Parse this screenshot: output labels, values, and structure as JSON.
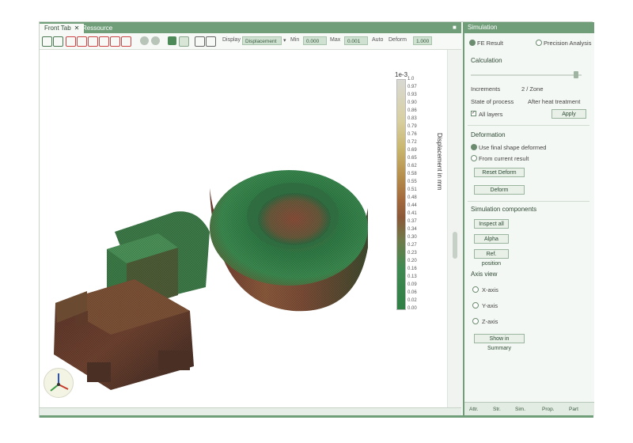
{
  "tabs": [
    {
      "label": "Front Tab",
      "close": "✕"
    },
    {
      "label": "Ressource"
    }
  ],
  "window": {
    "pin": "■"
  },
  "toolbar": {
    "display_label": "Display",
    "display_value": "Displacement",
    "min_label": "Min",
    "min_value": "0.000",
    "max_label": "Max",
    "max_value": "0.001",
    "auto_label": "Auto",
    "deform_label": "Deform",
    "deform_value": "1.000"
  },
  "colorbar": {
    "exponent": "1e-3",
    "ticks": [
      "1.0",
      "0.97",
      "0.93",
      "0.90",
      "0.86",
      "0.83",
      "0.79",
      "0.76",
      "0.72",
      "0.69",
      "0.65",
      "0.62",
      "0.58",
      "0.55",
      "0.51",
      "0.48",
      "0.44",
      "0.41",
      "0.37",
      "0.34",
      "0.30",
      "0.27",
      "0.23",
      "0.20",
      "0.16",
      "0.13",
      "0.09",
      "0.06",
      "0.02",
      "0.00"
    ],
    "title": "Displacement in mm",
    "colors": [
      "#d9d9d3",
      "#c9b66e",
      "#a46a3d",
      "#3f8a52",
      "#2f7f46"
    ]
  },
  "panel": {
    "title": "Simulation",
    "fe_result": "FE Result",
    "precision_analysis": "Precision Analysis",
    "calculation": "Calculation",
    "increments_label": "Increments",
    "increments_value": "2 / Zone",
    "state_label": "State of process",
    "state_value": "After heat treatment",
    "all_layers": "All layers",
    "apply_button": "Apply",
    "deformation_header": "Deformation",
    "use_last": "Use final shape deformed",
    "from_result": "From current result",
    "reset_button": "Reset Deform",
    "deform_button": "Deform",
    "sim_results_header": "Simulation components",
    "btn_auto": "Inspect all",
    "btn_alpha": "Alpha",
    "btn_ref": "Ref. position",
    "axis_header": "Axis view",
    "axis_x": "X-axis",
    "axis_y": "Y-axis",
    "axis_z": "Z-axis",
    "export_button": "Show in Summary",
    "bottom_tabs": [
      "Attr.",
      "Str.",
      "Sim.",
      "Prop.",
      "Part"
    ]
  }
}
